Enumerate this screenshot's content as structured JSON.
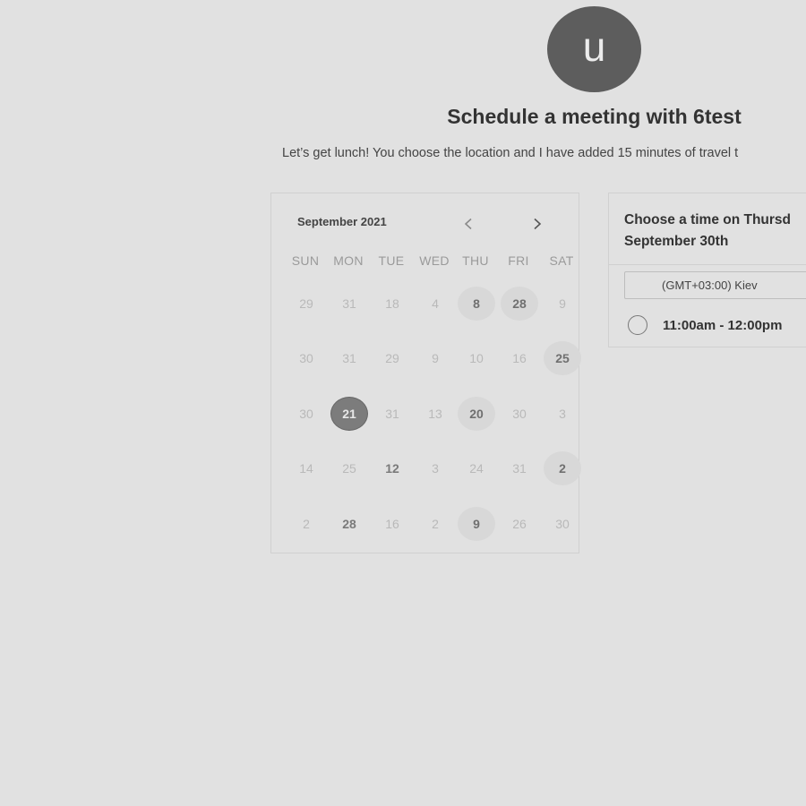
{
  "host": {
    "avatar_initial": "u",
    "title": "Schedule a meeting with 6test",
    "description": "Let’s get lunch! You choose the location and I have added 15 minutes of travel t"
  },
  "calendar": {
    "month_label": "September 2021",
    "prev_icon": "chevron-left-icon",
    "next_icon": "chevron-right-icon",
    "weekdays": [
      "SUN",
      "MON",
      "TUE",
      "WED",
      "THU",
      "FRI",
      "SAT"
    ],
    "weeks": [
      [
        {
          "d": "29"
        },
        {
          "d": "31"
        },
        {
          "d": "18"
        },
        {
          "d": "4"
        },
        {
          "d": "8",
          "s": "available"
        },
        {
          "d": "28",
          "s": "available"
        },
        {
          "d": "9"
        }
      ],
      [
        {
          "d": "30"
        },
        {
          "d": "31"
        },
        {
          "d": "29"
        },
        {
          "d": "9"
        },
        {
          "d": "10"
        },
        {
          "d": "16"
        },
        {
          "d": "25",
          "s": "available"
        }
      ],
      [
        {
          "d": "30"
        },
        {
          "d": "21",
          "s": "selected"
        },
        {
          "d": "31"
        },
        {
          "d": "13"
        },
        {
          "d": "20",
          "s": "available"
        },
        {
          "d": "30"
        },
        {
          "d": "3"
        }
      ],
      [
        {
          "d": "14"
        },
        {
          "d": "25"
        },
        {
          "d": "12",
          "s": "plain-bold"
        },
        {
          "d": "3"
        },
        {
          "d": "24"
        },
        {
          "d": "31"
        },
        {
          "d": "2",
          "s": "available"
        }
      ],
      [
        {
          "d": "2"
        },
        {
          "d": "28",
          "s": "plain-bold"
        },
        {
          "d": "16"
        },
        {
          "d": "2"
        },
        {
          "d": "9",
          "s": "available"
        },
        {
          "d": "26"
        },
        {
          "d": "30"
        }
      ]
    ]
  },
  "times": {
    "header": "Choose a time on Thursd September 30th",
    "timezone": "(GMT+03:00) Kiev",
    "slots": [
      {
        "label": "11:00am - 12:00pm"
      }
    ]
  }
}
